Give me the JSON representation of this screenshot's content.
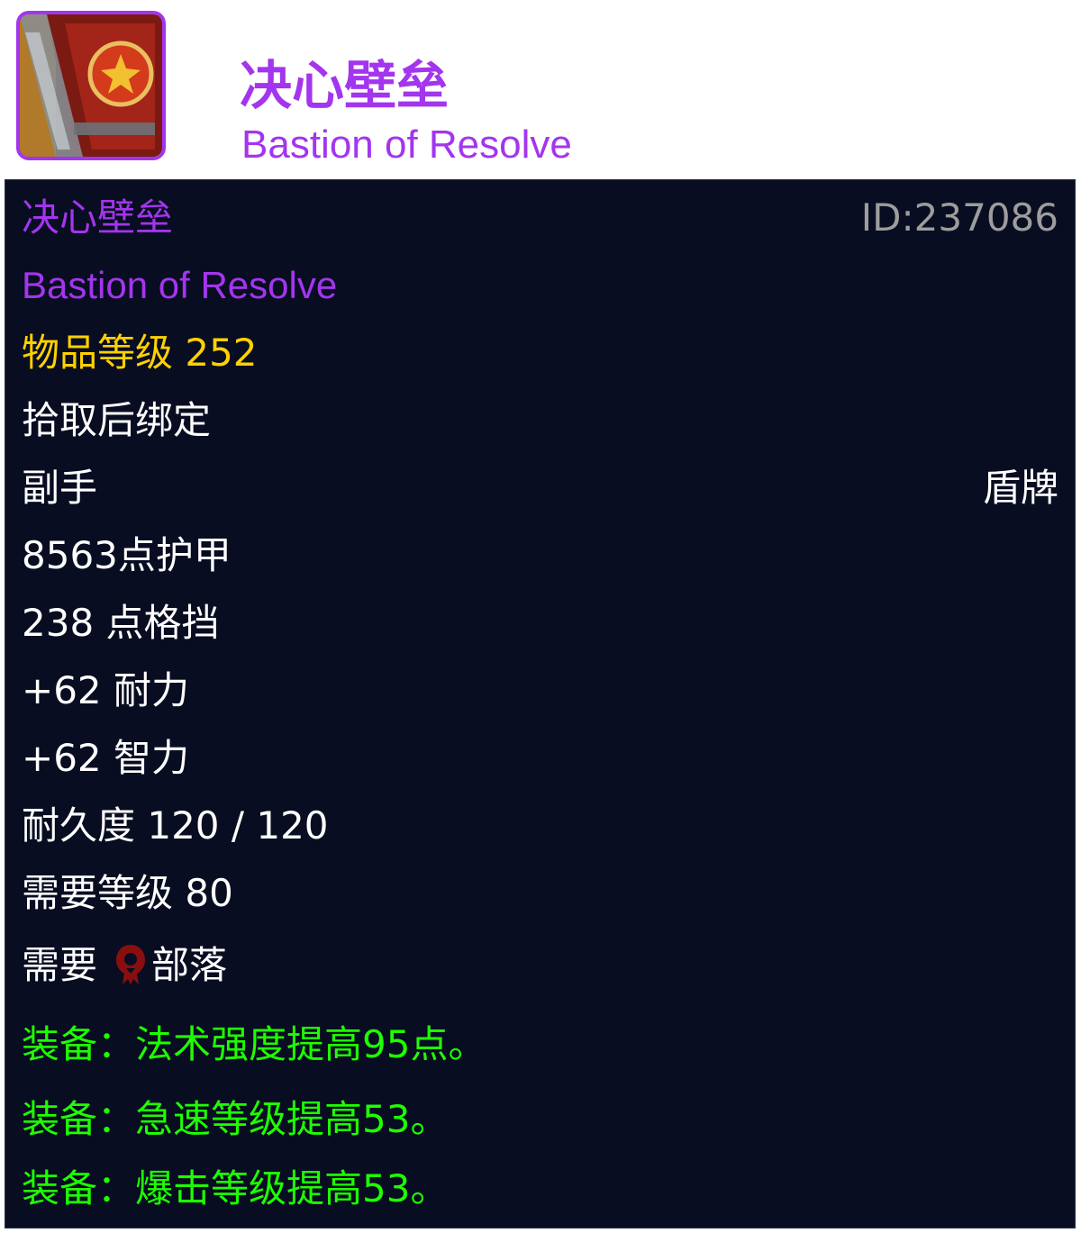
{
  "header": {
    "icon": "shield-item-icon",
    "title_cn": "决心壁垒",
    "title_en": "Bastion of Resolve",
    "quality_color": "#a335ee"
  },
  "tooltip": {
    "name_cn": "决心壁垒",
    "id_label": "ID:237086",
    "name_en": "Bastion of Resolve",
    "item_level": "物品等级 252",
    "binding": "拾取后绑定",
    "slot": "副手",
    "type": "盾牌",
    "armor": "8563点护甲",
    "block": "238 点格挡",
    "stamina": "+62 耐力",
    "intellect": "+62 智力",
    "durability": "耐久度 120 / 120",
    "required_level": "需要等级 80",
    "required_label": "需要",
    "faction_icon": "horde-icon",
    "faction_name": "部落",
    "effects": [
      "装备：法术强度提高95点。",
      "装备：急速等级提高53。",
      "装备：爆击等级提高53。"
    ],
    "colors": {
      "background": "#080d21",
      "epic": "#a335ee",
      "item_level": "#ffd100",
      "id": "#9d9d9d",
      "equip_effect": "#1eff00"
    }
  }
}
